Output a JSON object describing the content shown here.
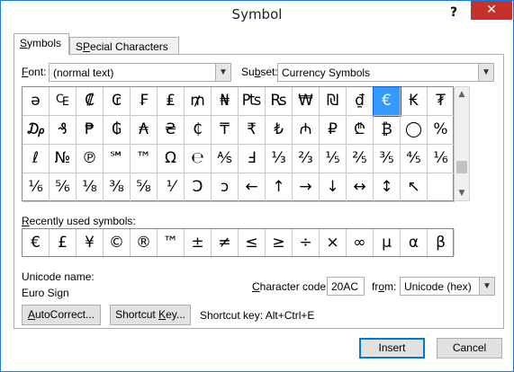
{
  "window": {
    "title": "Symbol",
    "help_glyph": "?",
    "close_glyph": "✕"
  },
  "tabs": [
    {
      "pre": "",
      "key": "S",
      "post": "ymbols"
    },
    {
      "pre": "",
      "key": "P",
      "post": "ecial Characters",
      "prefix2": "S"
    }
  ],
  "font": {
    "key": "F",
    "post": "ont:",
    "value": "(normal text)"
  },
  "subset": {
    "pre": "Su",
    "key": "b",
    "post": "set:",
    "value": "Currency Symbols"
  },
  "symbols": [
    [
      "ə",
      "₠",
      "₡",
      "₢",
      "₣",
      "₤",
      "₥",
      "₦",
      "₧",
      "₨",
      "₩",
      "₪",
      "₫",
      "€",
      "₭",
      "₮"
    ],
    [
      "₯",
      "₰",
      "₱",
      "₲",
      "₳",
      "₴",
      "₵",
      "₸",
      "₹",
      "₺",
      "₼",
      "₽",
      "₾",
      "₿",
      "◯",
      "%"
    ],
    [
      "ℓ",
      "№",
      "℗",
      "℠",
      "™",
      "Ω",
      "℮",
      "⅍",
      "Ⅎ",
      "⅓",
      "⅔",
      "⅕",
      "⅖",
      "⅗",
      "⅘",
      "⅙"
    ],
    [
      "⅙",
      "⅚",
      "⅛",
      "⅜",
      "⅝",
      "⅟",
      "Ↄ",
      "ↄ",
      "←",
      "↑",
      "→",
      "↓",
      "↔",
      "↕",
      "↖",
      ""
    ]
  ],
  "selected": {
    "row": 0,
    "col": 13
  },
  "recent": {
    "label_key": "R",
    "label_post": "ecently used symbols:",
    "items": [
      "€",
      "£",
      "¥",
      "©",
      "®",
      "™",
      "±",
      "≠",
      "≤",
      "≥",
      "÷",
      "×",
      "∞",
      "µ",
      "α",
      "β"
    ]
  },
  "unicode": {
    "label": "Unicode name:",
    "name": "Euro Sign"
  },
  "charcode": {
    "key": "C",
    "post": "haracter code:",
    "value": "20AC"
  },
  "from": {
    "pre": "fr",
    "key": "o",
    "post": "m:",
    "value": "Unicode (hex)"
  },
  "buttons": {
    "autocorrect_key": "A",
    "autocorrect_post": "utoCorrect...",
    "shortcut_pre": "Shortcut ",
    "shortcut_key": "K",
    "shortcut_post": "ey...",
    "insert": "Insert",
    "cancel": "Cancel"
  },
  "shortcut_text": "Shortcut key: Alt+Ctrl+E"
}
